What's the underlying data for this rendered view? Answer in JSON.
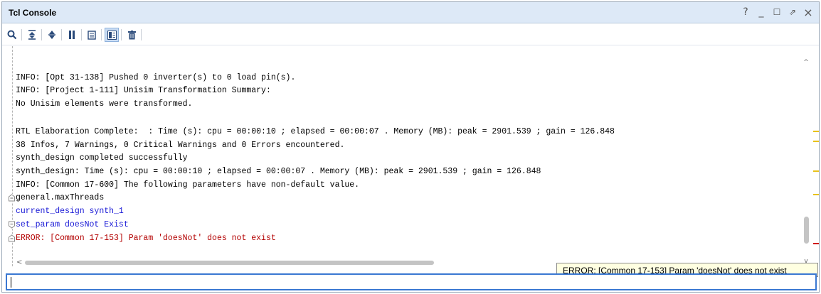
{
  "window": {
    "title": "Tcl Console",
    "controls": [
      {
        "name": "help",
        "glyph": "?"
      },
      {
        "name": "minimize",
        "glyph": "_"
      },
      {
        "name": "maximize",
        "glyph": "☐"
      },
      {
        "name": "float",
        "glyph": "⇗"
      },
      {
        "name": "close",
        "glyph": "×"
      }
    ]
  },
  "toolbar": {
    "buttons": [
      {
        "name": "search",
        "icon": "search-icon"
      },
      {
        "name": "collapse-all",
        "icon": "collapse-all-icon"
      },
      {
        "name": "expand-all",
        "icon": "expand-all-icon"
      },
      {
        "name": "pause-output",
        "icon": "pause-icon"
      },
      {
        "name": "copy",
        "icon": "copy-icon"
      },
      {
        "name": "show-commands",
        "icon": "show-commands-icon",
        "active": true
      },
      {
        "name": "clear",
        "icon": "trash-icon"
      }
    ]
  },
  "console": {
    "lines": [
      {
        "text": "INFO: [Opt 31-138] Pushed 0 inverter(s) to 0 load pin(s).",
        "kind": "info"
      },
      {
        "text": "INFO: [Project 1-111] Unisim Transformation Summary:",
        "kind": "info"
      },
      {
        "text": "No Unisim elements were transformed.",
        "kind": "info"
      },
      {
        "text": "",
        "kind": "info"
      },
      {
        "text": "RTL Elaboration Complete:  : Time (s): cpu = 00:00:10 ; elapsed = 00:00:07 . Memory (MB): peak = 2901.539 ; gain = 126.848",
        "kind": "info"
      },
      {
        "text": "38 Infos, 7 Warnings, 0 Critical Warnings and 0 Errors encountered.",
        "kind": "info"
      },
      {
        "text": "synth_design completed successfully",
        "kind": "info"
      },
      {
        "text": "synth_design: Time (s): cpu = 00:00:10 ; elapsed = 00:00:07 . Memory (MB): peak = 2901.539 ; gain = 126.848",
        "kind": "info"
      },
      {
        "text": "INFO: [Common 17-600] The following parameters have non-default value.",
        "kind": "info"
      },
      {
        "text": "general.maxThreads",
        "kind": "info",
        "fold": true
      },
      {
        "text": "current_design synth_1",
        "kind": "cmd"
      },
      {
        "text": "set_param doesNot Exist",
        "kind": "cmd",
        "fold": true
      },
      {
        "text": "ERROR: [Common 17-153] Param 'doesNot' does not exist",
        "kind": "err",
        "fold": true
      }
    ]
  },
  "markers": [
    {
      "color": "#e8c21c"
    },
    {
      "color": "#e8c21c"
    },
    {
      "color": "#e8c21c"
    },
    {
      "color": "#e8c21c"
    },
    {
      "color": "#d00000"
    }
  ],
  "tooltip": {
    "text": "ERROR: [Common 17-153] Param 'doesNot' does not exist"
  },
  "input": {
    "value": "",
    "placeholder": ""
  },
  "colors": {
    "info": "#000000",
    "cmd": "#1a1ad6",
    "err": "#b30000",
    "accent": "#3a78d2"
  }
}
